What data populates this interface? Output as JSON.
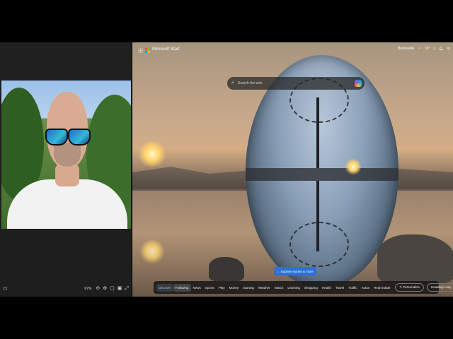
{
  "browser": {
    "brand": "Microsoft Start",
    "location": "Bonneville",
    "temperature": "76°",
    "search_placeholder": "Search the web",
    "explore_label": "Explore stories & more",
    "nav": [
      "Discover",
      "Following",
      "News",
      "Sports",
      "Play",
      "Money",
      "Gaming",
      "Weather",
      "Watch",
      "Learning",
      "Shopping",
      "Health",
      "Travel",
      "Traffic",
      "Autos",
      "Real Estate"
    ],
    "personalize": "Personalize",
    "headings": "Headings only"
  },
  "video_panel": {
    "zoom": "67%"
  },
  "icons": {
    "apps": "apps-grid-icon",
    "search": "search-icon",
    "copilot": "copilot-icon",
    "explore": "arrow-down-icon",
    "weather": "weather-icon",
    "phone": "phone-icon",
    "notifications": "bell-icon",
    "settings": "gear-icon"
  },
  "colors": {
    "ms_red": "#f25022",
    "ms_green": "#7fba00",
    "ms_blue": "#00a4ef",
    "ms_yellow": "#ffb900",
    "accent": "#2f6fdc"
  }
}
